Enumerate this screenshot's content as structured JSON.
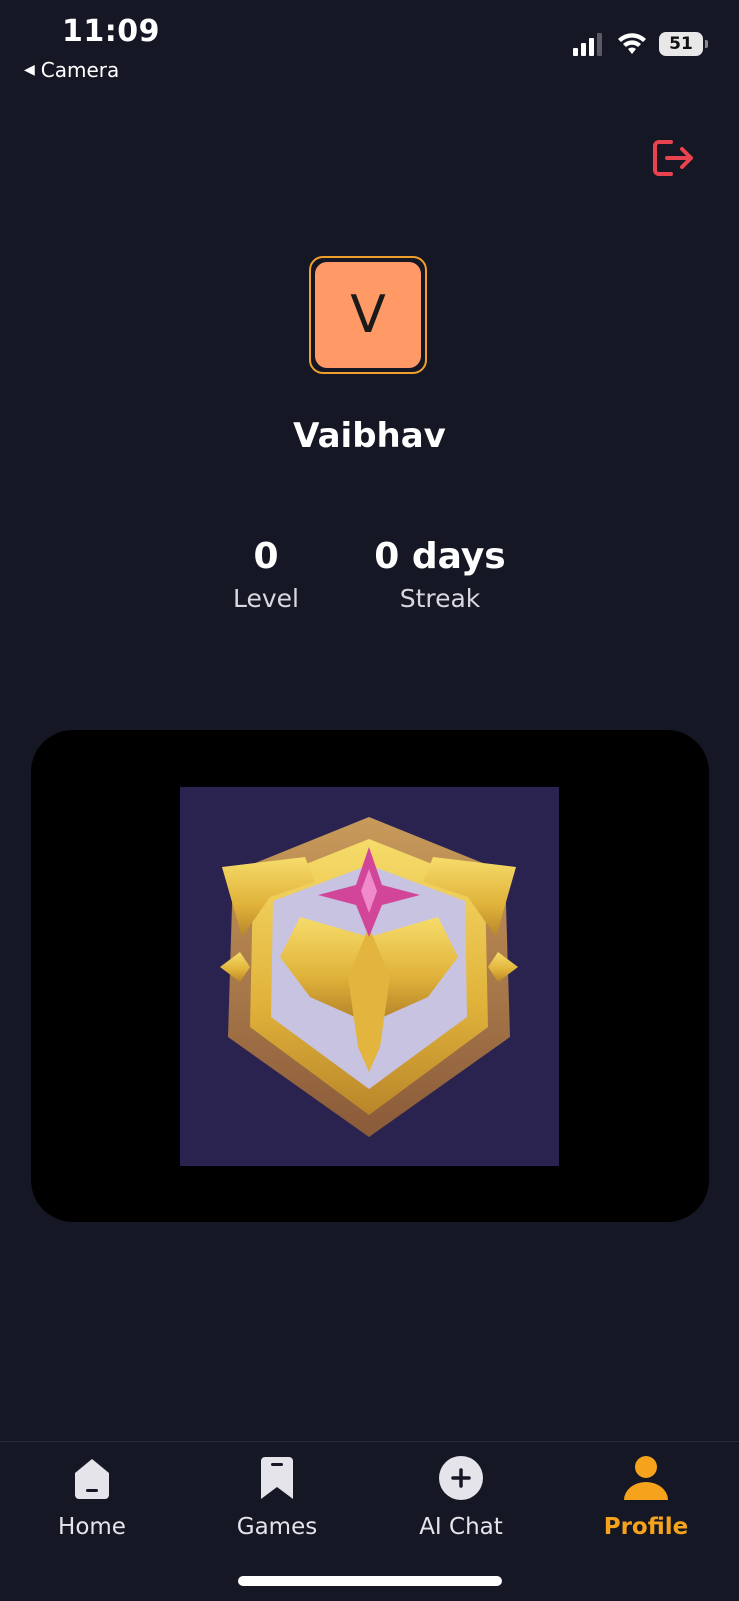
{
  "status_bar": {
    "time": "11:09",
    "back_app": "Camera",
    "battery": "51",
    "icons": [
      "signal-icon",
      "wifi-icon",
      "battery-icon"
    ]
  },
  "header": {
    "logout_icon": "logout-icon",
    "logout_color": "#e8434e"
  },
  "profile": {
    "avatar_letter": "V",
    "avatar_color": "#ff9966",
    "avatar_border_color": "#f0a02a",
    "name": "Vaibhav"
  },
  "stats": [
    {
      "value": "0",
      "label": "Level"
    },
    {
      "value": "0 days",
      "label": "Streak"
    }
  ],
  "badge": {
    "icon": "gold-eagle-shield-badge"
  },
  "tabs": [
    {
      "label": "Home",
      "icon": "home-icon",
      "active": false
    },
    {
      "label": "Games",
      "icon": "bookmark-icon",
      "active": false
    },
    {
      "label": "AI Chat",
      "icon": "plus-circle-icon",
      "active": false
    },
    {
      "label": "Profile",
      "icon": "person-icon",
      "active": true
    }
  ],
  "colors": {
    "background": "#161724",
    "accent": "#f5a21c",
    "card": "#000000"
  }
}
